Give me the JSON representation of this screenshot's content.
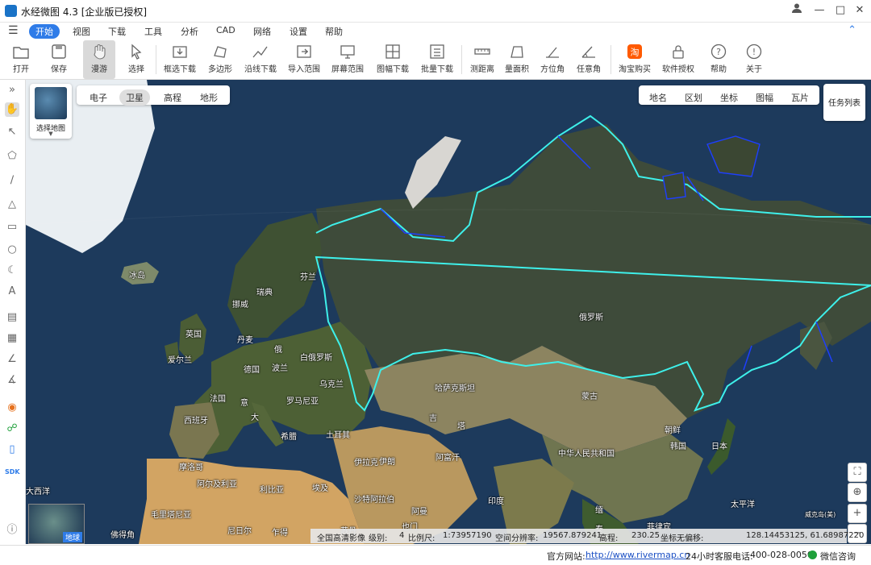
{
  "window": {
    "title": "水经微图 4.3 [企业版已授权]",
    "controls": [
      "user-icon",
      "minimize-icon",
      "maximize-icon",
      "close-icon"
    ]
  },
  "menu": {
    "items": [
      "开始",
      "视图",
      "下载",
      "工具",
      "分析",
      "CAD",
      "网络",
      "设置",
      "帮助"
    ],
    "active_index": 0
  },
  "toolbar": {
    "items": [
      {
        "label": "打开",
        "icon": "folder-icon"
      },
      {
        "label": "保存",
        "icon": "save-icon"
      },
      {
        "label": "漫游",
        "icon": "hand-icon",
        "selected": true
      },
      {
        "label": "选择",
        "icon": "cursor-icon"
      },
      {
        "label": "框选下载",
        "icon": "box-download-icon"
      },
      {
        "label": "多边形",
        "icon": "polygon-icon"
      },
      {
        "label": "沿线下载",
        "icon": "line-download-icon"
      },
      {
        "label": "导入范围",
        "icon": "import-icon"
      },
      {
        "label": "屏幕范围",
        "icon": "screen-icon"
      },
      {
        "label": "图幅下载",
        "icon": "grid-icon"
      },
      {
        "label": "批量下载",
        "icon": "batch-download-icon"
      },
      {
        "label": "测距离",
        "icon": "ruler-icon"
      },
      {
        "label": "量面积",
        "icon": "area-icon"
      },
      {
        "label": "方位角",
        "icon": "azimuth-icon"
      },
      {
        "label": "任意角",
        "icon": "angle-icon"
      },
      {
        "label": "淘宝购买",
        "icon": "taobao-icon"
      },
      {
        "label": "软件授权",
        "icon": "lock-icon"
      },
      {
        "label": "帮助",
        "icon": "help-icon"
      },
      {
        "label": "关于",
        "icon": "info-icon"
      }
    ]
  },
  "map_selector": {
    "label": "选择地图"
  },
  "map_types": {
    "items": [
      "电子",
      "卫星",
      "高程",
      "地形"
    ],
    "active_index": 1
  },
  "layers": {
    "items": [
      "地名",
      "区划",
      "坐标",
      "图幅",
      "瓦片"
    ]
  },
  "task_list": {
    "label": "任务列表"
  },
  "place_labels": [
    "冰岛",
    "芬兰",
    "瑞典",
    "挪威",
    "英国",
    "丹麦",
    "爱尔兰",
    "俄",
    "白俄罗斯",
    "德国",
    "波兰",
    "乌克兰",
    "法国",
    "意",
    "罗马尼亚",
    "西班牙",
    "大",
    "希腊",
    "土耳其",
    "俄罗斯",
    "哈萨克斯坦",
    "吉",
    "塔",
    "蒙古",
    "朝鲜",
    "韩国",
    "日本",
    "中华人民共和国",
    "伊拉克",
    "伊朗",
    "阿富汗",
    "摩洛哥",
    "阿尔及利亚",
    "利比亚",
    "埃及",
    "沙特阿拉伯",
    "阿曼",
    "印度",
    "缅",
    "泰",
    "菲律宾",
    "也门",
    "毛里塔尼亚",
    "尼日尔",
    "乍得",
    "苏丹",
    "佛得角",
    "大西洋",
    "太平洋",
    "威克岛(美)"
  ],
  "overview": {
    "label": "地球"
  },
  "status": {
    "source": "全国高清影像",
    "level_label": "级别:",
    "level": "4",
    "scale_label": "比例尺:",
    "scale": "1:73957190",
    "resolution_label": "空间分辨率:",
    "resolution": "19567.879241",
    "elevation_label": "高程:",
    "elevation": "230.25",
    "offset_label": "坐标无偏移:",
    "coords": "128.14453125, 61.68987220"
  },
  "footer": {
    "site_label": "官方网站:",
    "site_url": "http://www.rivermap.cn",
    "hotline_label": "24小时客服电话:",
    "hotline": "400-028-0050",
    "wechat": "微信咨询"
  },
  "colors": {
    "accent": "#2f7ce8",
    "border_highlight": "#3ef0ea",
    "border_secondary": "#1e3fff"
  }
}
